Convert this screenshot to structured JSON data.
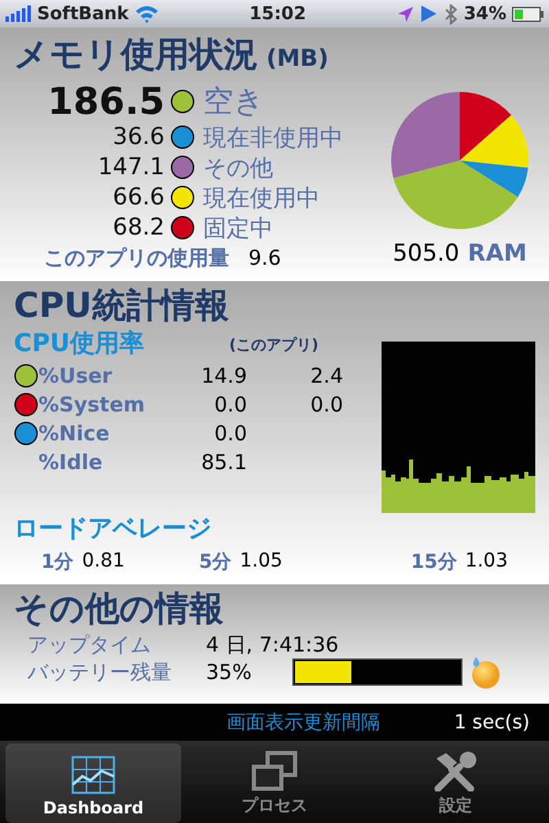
{
  "status_bar": {
    "carrier": "SoftBank",
    "time": "15:02",
    "battery": "34%"
  },
  "memory": {
    "title": "メモリ使用状況",
    "unit": "(MB)",
    "rows": [
      {
        "value": "186.5",
        "label": "空き",
        "color": "#9dc23a",
        "kind": "primary"
      },
      {
        "value": "36.6",
        "label": "現在非使用中",
        "color": "#1b8fd6",
        "kind": "normal"
      },
      {
        "value": "147.1",
        "label": "その他",
        "color": "#9b69a6",
        "kind": "normal"
      },
      {
        "value": "66.6",
        "label": "現在使用中",
        "color": "#f2e600",
        "kind": "normal"
      },
      {
        "value": "68.2",
        "label": "固定中",
        "color": "#d0021b",
        "kind": "normal"
      }
    ],
    "app_usage": {
      "label": "このアプリの使用量",
      "value": "9.6"
    },
    "total": {
      "value": "505.0",
      "label": "RAM"
    },
    "chart_data": {
      "type": "pie",
      "values": [
        13.5,
        13.19,
        7.25,
        36.93,
        29.13
      ],
      "colors": [
        "#d0021b",
        "#f2e600",
        "#1b8fd6",
        "#9dc23a",
        "#9b69a6"
      ]
    }
  },
  "cpu": {
    "title": "CPU統計情報",
    "usage_title": "CPU使用率",
    "app_column": "(このアプリ)",
    "rows": [
      {
        "label": "%User",
        "total": "14.9",
        "app": "2.4",
        "color": "#9dc23a"
      },
      {
        "label": "%System",
        "total": "0.0",
        "app": "0.0",
        "color": "#d0021b"
      },
      {
        "label": "%Nice",
        "total": "0.0",
        "color": "#1b8fd6"
      },
      {
        "label": "%Idle",
        "total": "85.1"
      }
    ],
    "load_title": "ロードアベレージ",
    "load": [
      {
        "label": "1分",
        "value": "0.81"
      },
      {
        "label": "5分",
        "value": "1.05"
      },
      {
        "label": "15分",
        "value": "1.03"
      }
    ]
  },
  "other": {
    "title": "その他の情報",
    "uptime": {
      "label": "アップタイム",
      "value": "4 日, 7:41:36"
    },
    "battery": {
      "label": "バッテリー残量",
      "value": "35%",
      "level": 0.35
    }
  },
  "refresh": {
    "label": "画面表示更新間隔",
    "value": "1 sec(s)"
  },
  "tabs": [
    {
      "label": "Dashboard",
      "selected": true,
      "kind": "dashboard"
    },
    {
      "label": "プロセス",
      "selected": false,
      "kind": "process"
    },
    {
      "label": "設定",
      "selected": false,
      "kind": "settings"
    }
  ]
}
